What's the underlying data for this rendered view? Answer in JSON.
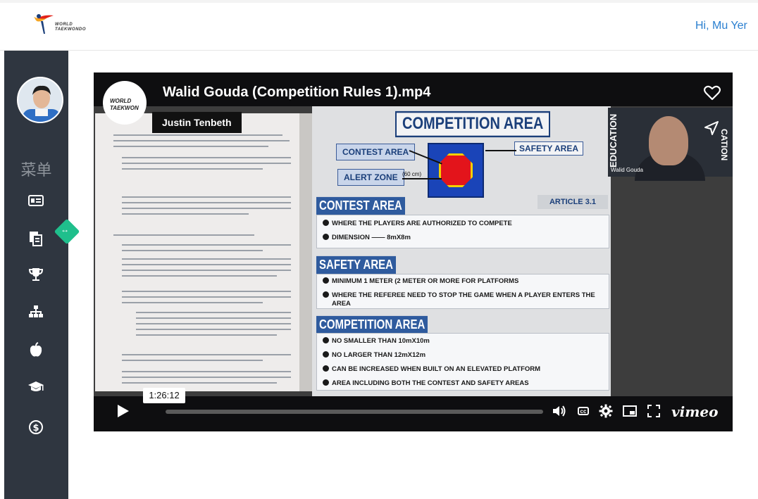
{
  "header": {
    "logo_line1": "WORLD",
    "logo_line2": "TAEKWONDO",
    "greeting": "Hi, Mu Yer"
  },
  "sidebar": {
    "menu_title": "菜单",
    "items": [
      {
        "icon": "id-card-icon"
      },
      {
        "icon": "documents-icon"
      },
      {
        "icon": "trophy-icon"
      },
      {
        "icon": "sitemap-icon"
      },
      {
        "icon": "apple-icon"
      },
      {
        "icon": "graduation-cap-icon"
      },
      {
        "icon": "dollar-icon"
      }
    ]
  },
  "player": {
    "title": "Walid Gouda (Competition Rules 1).mp4",
    "badge_line1": "WORLD",
    "badge_line2": "TAEKWON",
    "presenter": "Justin Tenbeth",
    "timestamp": "1:26:12",
    "brand": "vimeo",
    "progress": 0.0
  },
  "slide": {
    "title": "COMPETITION AREA",
    "contest_area_label": "CONTEST AREA",
    "safety_area_label": "SAFETY AREA",
    "alert_zone_label": "ALERT ZONE",
    "alert_zone_size": "(60 cm)",
    "article": "ARTICLE 3.1",
    "sections": [
      {
        "heading": "CONTEST AREA",
        "bullets": [
          "WHERE THE PLAYERS ARE AUTHORIZED TO COMPETE",
          "DIMENSION  ——  8mX8m"
        ]
      },
      {
        "heading": "SAFETY AREA",
        "bullets": [
          "MINIMUM 1 METER (2 METER OR MORE FOR PLATFORMS",
          "WHERE THE REFEREE NEED TO STOP THE GAME WHEN A PLAYER ENTERS THE",
          "AREA"
        ]
      },
      {
        "heading": "COMPETITION AREA",
        "bullets": [
          "NO SMALLER THAN 10mX10m",
          "NO LARGER THAN 12mX12m",
          "CAN BE INCREASED WHEN BUILT ON AN ELEVATED PLATFORM",
          "AREA INCLUDING BOTH THE CONTEST AND SAFETY AREAS"
        ]
      }
    ]
  },
  "webcam": {
    "name": "Walid Gouda",
    "strip_left": "EDUCATION",
    "strip_right": "CATION"
  }
}
